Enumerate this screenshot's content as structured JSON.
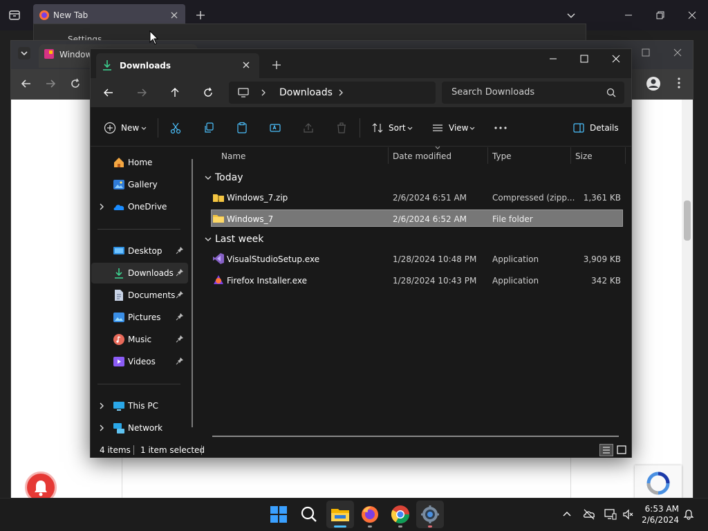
{
  "firefox": {
    "tab_title": "New Tab"
  },
  "settings_window": {
    "title": "Settings"
  },
  "chrome": {
    "tab_title": "Window"
  },
  "explorer": {
    "tab_title": "Downloads",
    "breadcrumb": [
      "Downloads"
    ],
    "search_placeholder": "Search Downloads",
    "commands": {
      "new": "New",
      "sort": "Sort",
      "view": "View",
      "details": "Details"
    },
    "columns": {
      "name": "Name",
      "date": "Date modified",
      "type": "Type",
      "size": "Size"
    },
    "sidebar": {
      "home": "Home",
      "gallery": "Gallery",
      "onedrive": "OneDrive",
      "desktop": "Desktop",
      "downloads": "Downloads",
      "documents": "Documents",
      "pictures": "Pictures",
      "music": "Music",
      "videos": "Videos",
      "thispc": "This PC",
      "network": "Network"
    },
    "groups": {
      "today": "Today",
      "lastweek": "Last week"
    },
    "files": [
      {
        "name": "Windows_7.zip",
        "date": "2/6/2024 6:51 AM",
        "type": "Compressed (zipp...",
        "size": "1,361 KB"
      },
      {
        "name": "Windows_7",
        "date": "2/6/2024 6:52 AM",
        "type": "File folder",
        "size": ""
      },
      {
        "name": "VisualStudioSetup.exe",
        "date": "1/28/2024 10:48 PM",
        "type": "Application",
        "size": "3,909 KB"
      },
      {
        "name": "Firefox Installer.exe",
        "date": "1/28/2024 10:43 PM",
        "type": "Application",
        "size": "342 KB"
      }
    ],
    "status": {
      "items": "4 items",
      "selected": "1 item selected"
    }
  },
  "taskbar": {
    "time": "6:53 AM",
    "date": "2/6/2024"
  },
  "colors": {
    "accent": "#4cc2ff",
    "folder": "#f4c542",
    "selection": "#777777"
  }
}
